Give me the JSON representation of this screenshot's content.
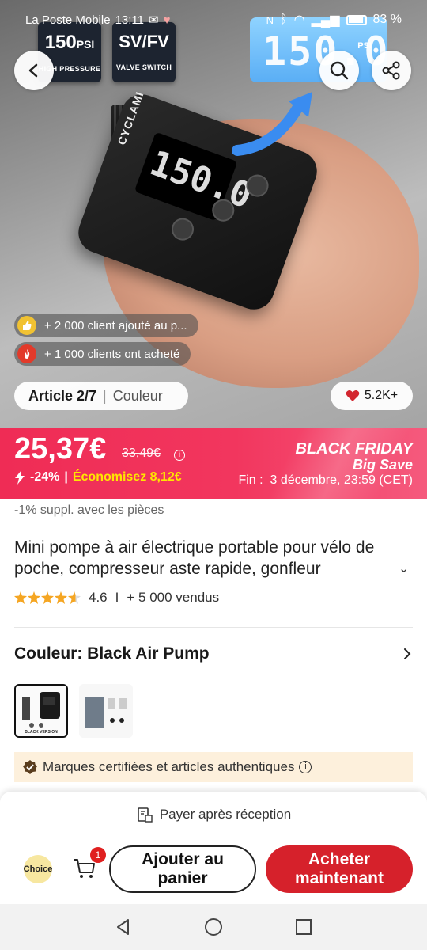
{
  "status_bar": {
    "carrier": "La Poste Mobile",
    "time": "13:11",
    "battery": "83 %"
  },
  "hero": {
    "badge_pressure_value": "150",
    "badge_pressure_unit": "PSI",
    "badge_pressure_caption": "HIGH PRESSURE",
    "badge_valve_value": "SV/FV",
    "badge_valve_caption": "VALVE SWITCH",
    "lcd_value": "150.0",
    "lcd_unit": "PSI",
    "device_screen_value": "150.0",
    "device_brand": "CYCLAMI",
    "notice_1": "+ 2 000 client ajouté au p...",
    "notice_2": "+ 1 000 clients ont acheté",
    "article_label": "Article 2/7",
    "article_sep": "|",
    "article_color": "Couleur",
    "likes": "5.2K+"
  },
  "price": {
    "current": "25,37€",
    "original": "33,49€",
    "discount": "-24%",
    "sep": "|",
    "savings": "Économisez 8,12€",
    "promo_title": "BLACK FRIDAY",
    "promo_sub": "Big Save",
    "end_label": "Fin :",
    "end_date": "3 décembre, 23:59 (CET)"
  },
  "product": {
    "extra_discount": "-1% suppl. avec les pièces",
    "title": "Mini pompe à air électrique portable pour vélo de poche, compresseur aste rapide, gonfleur",
    "rating": "4.6",
    "rating_sep": "I",
    "sold": "+ 5 000 vendus",
    "rating_value": 4.6,
    "color_label": "Couleur: Black Air Pump",
    "thumb_1_caption": "BLACK VERSION",
    "certified": "Marques certifiées et articles authentiques"
  },
  "bottom": {
    "pay_label": "Payer après réception",
    "choice_label": "Choice",
    "cart_count": "1",
    "add_to_cart": "Ajouter au panier",
    "buy_now": "Acheter maintenant"
  },
  "colors": {
    "price_banner": "#ef2c55",
    "buy_button": "#d6212b",
    "savings_text": "#ffe600",
    "star": "#f5a623",
    "cert_bg": "#fdf0dc"
  },
  "icons": [
    "back-arrow-icon",
    "search-icon",
    "share-icon",
    "thumbs-up-icon",
    "fire-icon",
    "heart-icon",
    "info-icon",
    "lightning-icon",
    "chevron-down-icon",
    "chevron-right-icon",
    "verified-check-icon",
    "cash-on-delivery-icon",
    "cart-icon",
    "nav-back-icon",
    "nav-home-icon",
    "nav-recents-icon"
  ]
}
